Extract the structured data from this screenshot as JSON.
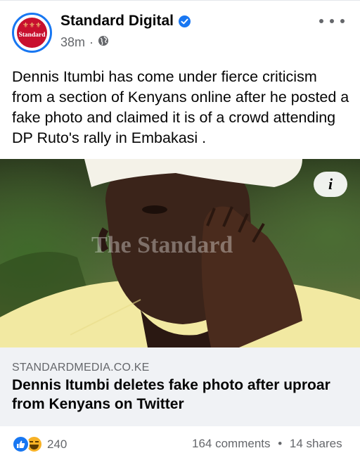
{
  "post": {
    "page_name": "Standard Digital",
    "verified": true,
    "avatar_text": "Standard",
    "avatar_crest": "⚜⚜⚜",
    "time": "38m",
    "separator": "·",
    "privacy_icon": "globe-icon",
    "text": "Dennis Itumbi has come under fierce criticism from a section of Kenyans online after he posted a fake photo and claimed it is of a crowd attending DP Ruto's rally in Embakasi ."
  },
  "image": {
    "watermark": "The Standard",
    "info_label": "i"
  },
  "link": {
    "domain": "STANDARDMEDIA.CO.KE",
    "title": "Dennis Itumbi deletes fake photo after uproar from Kenyans on Twitter"
  },
  "engagement": {
    "reactions": [
      "like-icon",
      "haha-icon"
    ],
    "reaction_count": "240",
    "comments": "164 comments",
    "dot": "•",
    "shares": "14 shares"
  },
  "colors": {
    "accent": "#1877f2",
    "brand_red": "#c8102e",
    "muted_text": "#65676b",
    "preview_bg": "#f0f2f5"
  }
}
